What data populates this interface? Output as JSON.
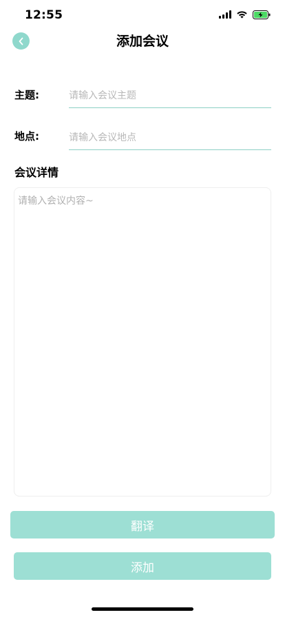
{
  "status_bar": {
    "time": "12:55"
  },
  "nav": {
    "title": "添加会议",
    "back_icon": "chevron-left-icon"
  },
  "form": {
    "topic": {
      "label": "主题:",
      "value": "",
      "placeholder": "请输入会议主题"
    },
    "location": {
      "label": "地点:",
      "value": "",
      "placeholder": "请输入会议地点"
    },
    "details": {
      "label": "会议详情",
      "value": "",
      "placeholder": "请输入会议内容~"
    }
  },
  "actions": {
    "translate_label": "翻译",
    "add_label": "添加"
  },
  "colors": {
    "accent": "#9ddfd4",
    "back_button": "#8fd8cc",
    "input_underline": "#8ccfc4",
    "battery_fill": "#4cd964"
  }
}
